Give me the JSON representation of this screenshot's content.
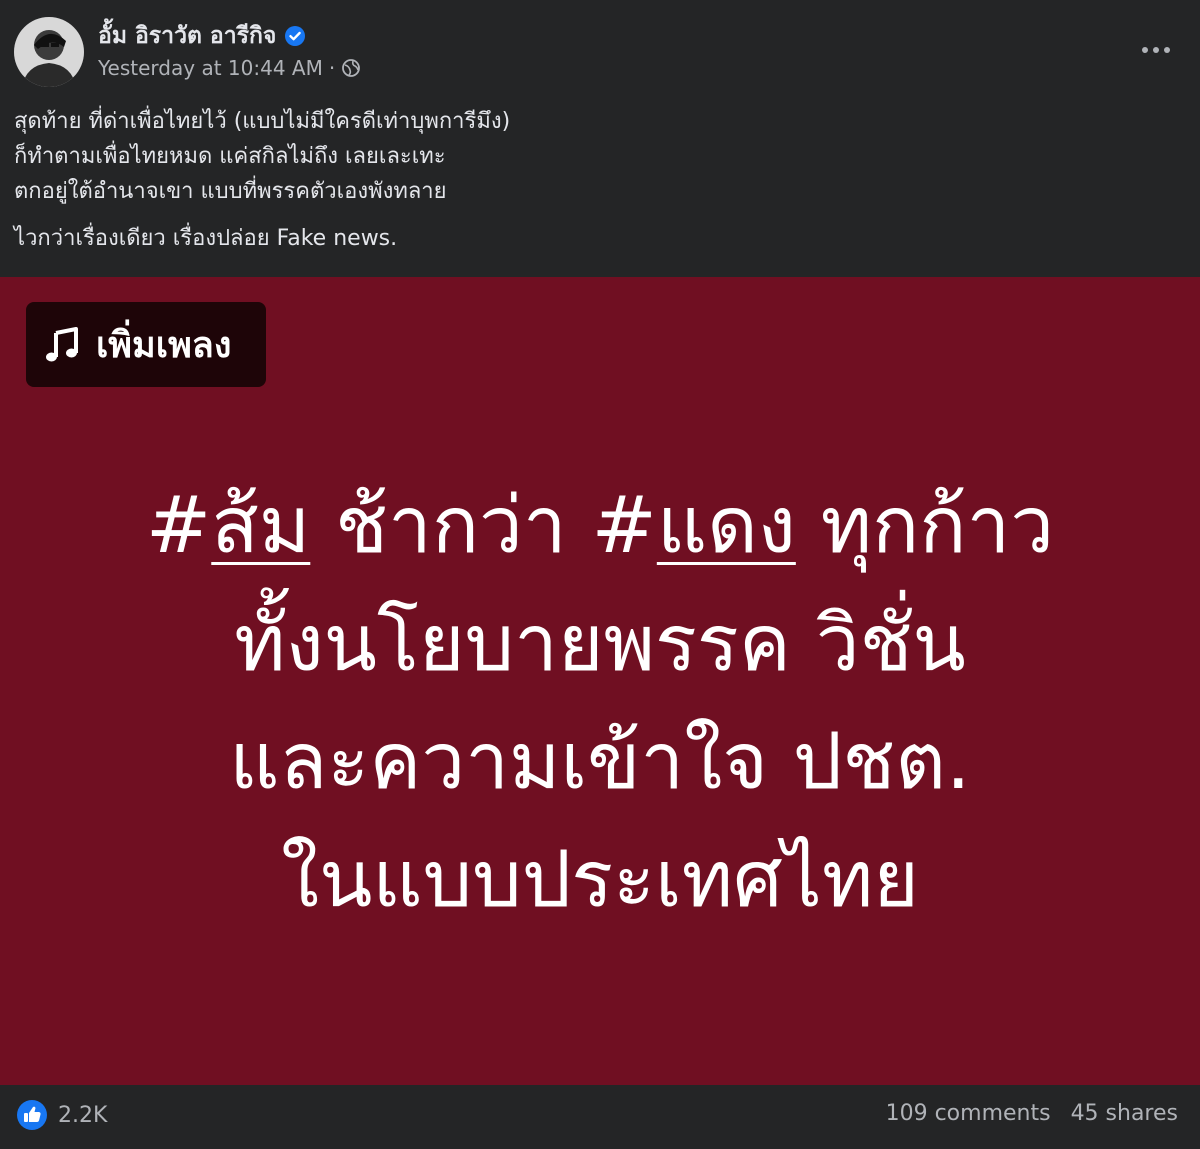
{
  "post": {
    "author": {
      "name": "อั้ม อิราวัต อารีกิจ",
      "verified": true,
      "avatar_icon": "profile-photo"
    },
    "meta": {
      "timestamp": "Yesterday at 10:44 AM",
      "separator": "·",
      "audience_icon": "globe-icon"
    },
    "more_icon": "more-horizontal-icon",
    "caption": {
      "lines": [
        "สุดท้าย ที่ด่าเพื่อไทยไว้ (แบบไม่มีใครดีเท่าบุพการีมึง)",
        "ก็ทำตามเพื่อไทยหมด แค่สกิลไม่ถึง เลยเละเทะ",
        "ตกอยู่ใต้อำนาจเขา แบบที่พรรคตัวเองพังทลาย",
        "ไวกว่าเรื่องเดียว  เรื่องปล่อย Fake news."
      ]
    },
    "image": {
      "background_color": "#700f22",
      "music_chip": {
        "icon": "music-note-icon",
        "label": "เพิ่มเพลง"
      },
      "headline": {
        "line1": {
          "hash1": "#",
          "tag1": "ส้ม",
          "mid": " ช้ากว่า ",
          "hash2": "#",
          "tag2": "แดง",
          "end": " ทุกก้าว"
        },
        "line2": "ทั้งนโยบายพรรค วิชั่น",
        "line3": "และความเข้าใจ ปชต.",
        "line4": "ในแบบประเทศไทย"
      }
    },
    "footer": {
      "reaction_icon": "like-icon",
      "reaction_count": "2.2K",
      "comments": "109 comments",
      "shares": "45 shares"
    }
  },
  "colors": {
    "background": "#242526",
    "text_primary": "#e4e6eb",
    "text_secondary": "#b0b3b8",
    "accent_blue": "#1877f2",
    "image_background": "#700f22"
  }
}
